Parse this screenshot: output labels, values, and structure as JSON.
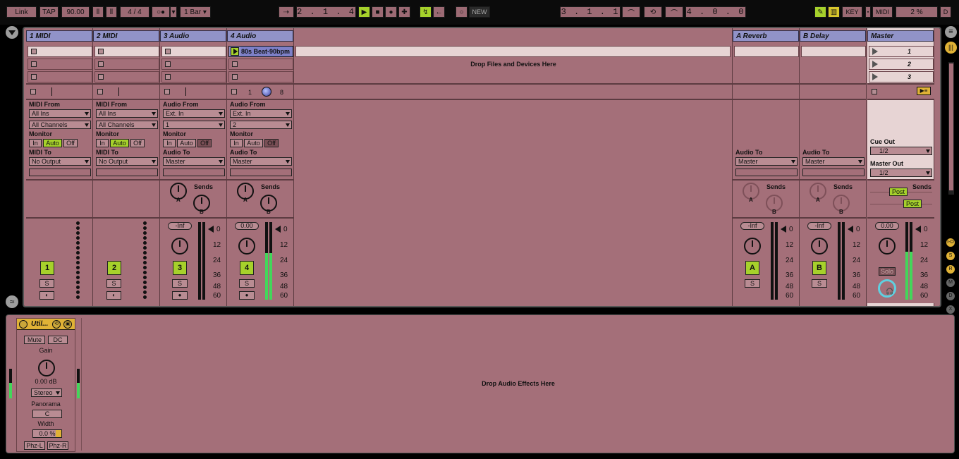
{
  "transport": {
    "link": "Link",
    "tap": "TAP",
    "tempo": "90.00",
    "signature": "4 / 4",
    "quantize": "1 Bar",
    "arrangement_position": "2 . 1 . 4",
    "new_label": "NEW",
    "loop_start": "3 . 1 . 1",
    "loop_length": "4 . 0 . 0",
    "key": "KEY",
    "midi": "MIDI",
    "cpu": "2 %",
    "disk": "D"
  },
  "tracks": [
    {
      "name": "1 MIDI",
      "number": "1",
      "in_label": "MIDI From",
      "in_source": "All Ins",
      "in_channel": "All Channels",
      "monitor_label": "Monitor",
      "mon_in": "In",
      "mon_auto": "Auto",
      "mon_off": "Off",
      "out_label": "MIDI To",
      "out_target": "No Output",
      "solo": "S"
    },
    {
      "name": "2 MIDI",
      "number": "2",
      "in_label": "MIDI From",
      "in_source": "All Ins",
      "in_channel": "All Channels",
      "monitor_label": "Monitor",
      "mon_in": "In",
      "mon_auto": "Auto",
      "mon_off": "Off",
      "out_label": "MIDI To",
      "out_target": "No Output",
      "solo": "S"
    },
    {
      "name": "3 Audio",
      "number": "3",
      "in_label": "Audio From",
      "in_source": "Ext. In",
      "in_channel": "1",
      "monitor_label": "Monitor",
      "mon_in": "In",
      "mon_auto": "Auto",
      "mon_off": "Off",
      "out_label": "Audio To",
      "out_target": "Master",
      "solo": "S",
      "sends": "Sends",
      "volume": "-Inf"
    },
    {
      "name": "4 Audio",
      "number": "4",
      "in_label": "Audio From",
      "in_source": "Ext. In",
      "in_channel": "2",
      "monitor_label": "Monitor",
      "mon_in": "In",
      "mon_auto": "Auto",
      "mon_off": "Off",
      "out_label": "Audio To",
      "out_target": "Master",
      "solo": "S",
      "sends": "Sends",
      "volume": "0.00",
      "clip": "80s Beat-90bpm",
      "clip_stop_left": "1",
      "clip_stop_right": "8",
      "meter_level": 0.6
    }
  ],
  "returns": [
    {
      "name": "A Reverb",
      "letter": "A",
      "out_label": "Audio To",
      "out_target": "Master",
      "sends": "Sends",
      "volume": "-Inf",
      "solo": "S"
    },
    {
      "name": "B Delay",
      "letter": "B",
      "out_label": "Audio To",
      "out_target": "Master",
      "sends": "Sends",
      "volume": "-Inf",
      "solo": "S"
    }
  ],
  "master": {
    "name": "Master",
    "scenes": [
      "1",
      "2",
      "3"
    ],
    "cue_label": "Cue Out",
    "cue_value": "1/2",
    "master_label": "Master Out",
    "master_value": "1/2",
    "sends": "Sends",
    "post": "Post",
    "volume": "0.00",
    "solo": "Solo",
    "meter_level": 0.62
  },
  "drop_files": "Drop Files and Devices Here",
  "send_labels": [
    "A",
    "B"
  ],
  "meter_scale": [
    "0",
    "12",
    "24",
    "36",
    "48",
    "60"
  ],
  "device": {
    "title": "Util...",
    "mute": "Mute",
    "dc": "DC",
    "gain_label": "Gain",
    "gain_value": "0.00 dB",
    "channel_mode": "Stereo",
    "pan_label": "Panorama",
    "pan_value": "C",
    "width_label": "Width",
    "width_value": "0.0 %",
    "phz_l": "Phz-L",
    "phz_r": "Phz-R"
  },
  "drop_effects": "Drop Audio Effects Here",
  "side_buttons": [
    "I-O",
    "S",
    "R",
    "M",
    "D",
    "X"
  ],
  "colors": {
    "accent": "#a6d12b",
    "track_bg": "#a46f79",
    "header": "#9193c8",
    "meter": "#43d65a"
  }
}
